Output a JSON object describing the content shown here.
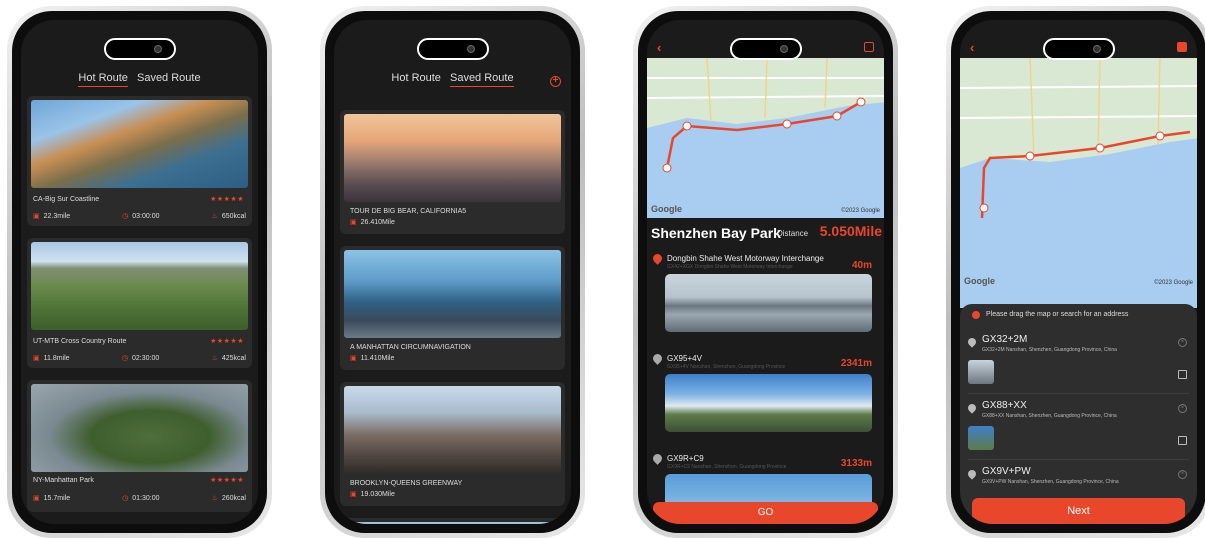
{
  "colors": {
    "accent": "#e8472b",
    "background": "#1b1b1b",
    "card": "#2b2b2b"
  },
  "screen1": {
    "tabs": [
      "Hot Route",
      "Saved Route"
    ],
    "active_tab": "Hot Route",
    "routes": [
      {
        "name": "CA-Big Sur Coastline",
        "stars": "★★★★★",
        "distance": "22.3mile",
        "time": "03:00:00",
        "calories": "650kcal"
      },
      {
        "name": "UT-MTB Cross Country Route",
        "stars": "★★★★★",
        "distance": "11.8mile",
        "time": "02:30:00",
        "calories": "425kcal"
      },
      {
        "name": "NY-Manhattan Park",
        "stars": "★★★★★",
        "distance": "15.7mile",
        "time": "01:30:00",
        "calories": "260kcal"
      }
    ]
  },
  "screen2": {
    "tabs": [
      "Hot Route",
      "Saved Route"
    ],
    "active_tab": "Saved Route",
    "routes": [
      {
        "title": "TOUR DE BIG BEAR, CALIFORNIA5",
        "distance": "26.410Mile"
      },
      {
        "title": "A MANHATTAN CIRCUMNAVIGATION",
        "distance": "11.410Mile"
      },
      {
        "title": "BROOKLYN-QUEENS GREENWAY",
        "distance": "19.030Mile"
      }
    ]
  },
  "screen3": {
    "map_attribution": "©2023 Google",
    "map_logo": "Google",
    "park_name": "Shenzhen Bay Park",
    "distance_label": "Distance",
    "distance_value": "5.050Mile",
    "waypoints": [
      {
        "name": "Dongbin Shahe West Motorway Interchange",
        "address": "GX42+XGX Dongbin Shahe West Motorway Interchange",
        "distance": "40m"
      },
      {
        "name": "GX95+4V",
        "address": "GX95+4V Nanshan, Shenzhen, Guangdong Province",
        "distance": "2341m"
      },
      {
        "name": "GX9R+C9",
        "address": "GX9R+C9 Nanshan, Shenzhen, Guangdong Province",
        "distance": "3133m"
      }
    ],
    "go_label": "GO"
  },
  "screen4": {
    "map_attribution": "©2023 Google",
    "map_logo": "Google",
    "hint": "Please drag the map or search for an address",
    "addresses": [
      {
        "code": "GX32+2M",
        "detail": "GX32+2M Nanshan, Shenzhen, Guangdong Province, China"
      },
      {
        "code": "GX88+XX",
        "detail": "GX88+XX Nanshan, Shenzhen, Guangdong Province, China"
      },
      {
        "code": "GX9V+PW",
        "detail": "GX9V+PW Nanshan, Shenzhen, Guangdong Province, China"
      }
    ],
    "next_label": "Next"
  }
}
